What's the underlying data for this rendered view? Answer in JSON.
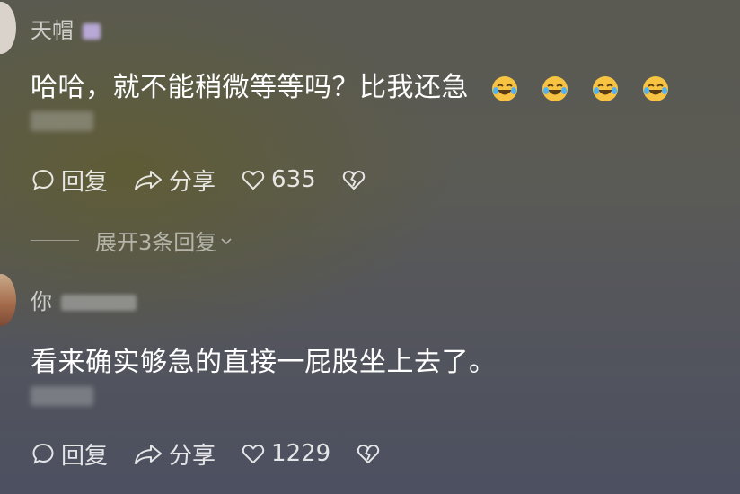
{
  "comments": [
    {
      "username": "天帽",
      "text": "哈哈，就不能稍微等等吗？比我还急",
      "emojis": [
        "laughing-tears-icon",
        "laughing-tears-icon",
        "laughing-tears-icon",
        "laughing-tears-icon"
      ],
      "reply_label": "回复",
      "share_label": "分享",
      "like_count": "635"
    },
    {
      "username": "你",
      "text": "看来确实够急的直接一屁股坐上去了。",
      "reply_label": "回复",
      "share_label": "分享",
      "like_count": "1229"
    }
  ],
  "expand_replies_label": "展开3条回复",
  "colors": {
    "text": "#ffffff",
    "muted": "#c8c8c8"
  }
}
